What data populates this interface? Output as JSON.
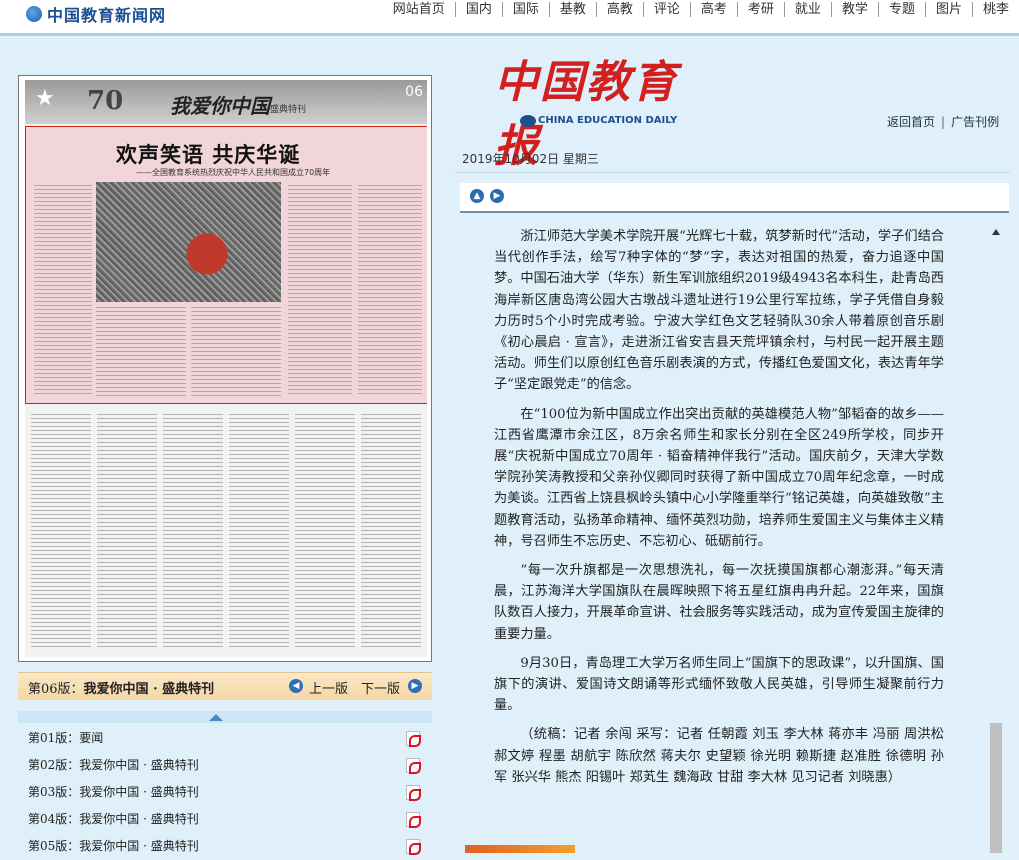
{
  "site": {
    "logo_text": "中国教育新闻网"
  },
  "nav": [
    "网站首页",
    "国内",
    "国际",
    "基教",
    "高教",
    "评论",
    "高考",
    "考研",
    "就业",
    "教学",
    "专题",
    "图片",
    "桃李"
  ],
  "paper": {
    "slogan": "我爱你中国",
    "sub": "盛典特刊",
    "seventy": "70",
    "page_no": "06",
    "headline": "欢声笑语  共庆华诞",
    "subline": "——全国教育系统热烈庆祝中华人民共和国成立70周年"
  },
  "edition_bar": {
    "label_prefix": "第06版：",
    "label_name": "我爱你中国 · 盛典特刊",
    "prev_label": "上一版",
    "next_label": "下一版"
  },
  "edition_list": [
    {
      "label": "第01版：要闻"
    },
    {
      "label": "第02版：我爱你中国 · 盛典特刊"
    },
    {
      "label": "第03版：我爱你中国 · 盛典特刊"
    },
    {
      "label": "第04版：我爱你中国 · 盛典特刊"
    },
    {
      "label": "第05版：我爱你中国 · 盛典特刊"
    }
  ],
  "brand": {
    "cn": "中国教育报",
    "en": "CHINA EDUCATION DAILY"
  },
  "right_links": {
    "home": "返回首页",
    "ads": "广告刊例"
  },
  "date": "2019年10月02日  星期三",
  "article": {
    "paragraphs": [
      "浙江师范大学美术学院开展“光辉七十载，筑梦新时代”活动，学子们结合当代创作手法，绘写7种字体的“梦”字，表达对祖国的热爱，奋力追逐中国梦。中国石油大学（华东）新生军训旅组织2019级4943名本科生，赴青岛西海岸新区唐岛湾公园大古墩战斗遗址进行19公里行军拉练，学子凭借自身毅力历时5个小时完成考验。宁波大学红色文艺轻骑队30余人带着原创音乐剧《初心晨启 · 宣言》，走进浙江省安吉县天荒坪镇余村，与村民一起开展主题活动。师生们以原创红色音乐剧表演的方式，传播红色爱国文化，表达青年学子“坚定跟党走”的信念。",
      "在“100位为新中国成立作出突出贡献的英雄模范人物”邹韬奋的故乡——江西省鹰潭市余江区，8万余名师生和家长分别在全区249所学校，同步开展“庆祝新中国成立70周年 · 韬奋精神伴我行”活动。国庆前夕，天津大学数学院孙笑涛教授和父亲孙仪卿同时获得了新中国成立70周年纪念章，一时成为美谈。江西省上饶县枫岭头镇中心小学隆重举行“铭记英雄，向英雄致敬”主题教育活动，弘扬革命精神、缅怀英烈功勋，培养师生爱国主义与集体主义精神，号召师生不忘历史、不忘初心、砥砺前行。",
      "“每一次升旗都是一次思想洗礼，每一次抚摸国旗都心潮澎湃。”每天清晨，江苏海洋大学国旗队在晨晖映照下将五星红旗冉冉升起。22年来，国旗队数百人接力，开展革命宣讲、社会服务等实践活动，成为宣传爱国主旋律的重要力量。",
      "9月30日，青岛理工大学万名师生同上“国旗下的思政课”，以升国旗、国旗下的演讲、爱国诗文朗诵等形式缅怀致敬人民英雄，引导师生凝聚前行力量。",
      "（统稿：记者 余闯 采写：记者 任朝霞 刘玉 李大林 蒋亦丰 冯丽 周洪松 郝文婷 程墨 胡航宇 陈欣然 蒋夫尔 史望颖 徐光明 赖斯捷 赵准胜 徐德明 孙军 张兴华 熊杰 阳锡叶 郑芄生 魏海政 甘甜 李大林 见习记者 刘晓惠）"
    ]
  },
  "colors": {
    "brand_red": "#d21f1f",
    "nav_blue": "#1b4f94",
    "highlight_border": "#cc2211"
  }
}
